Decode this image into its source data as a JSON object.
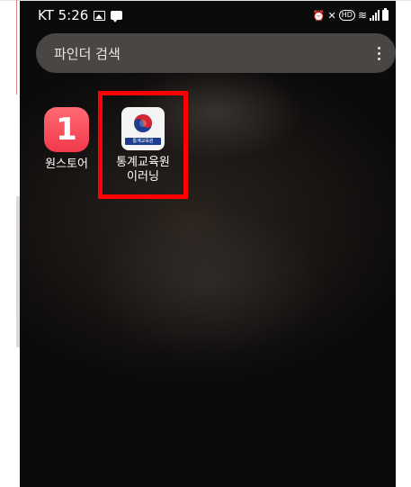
{
  "status_bar": {
    "time": "KT 5:26",
    "left_icons": [
      "gallery-icon",
      "message-icon"
    ],
    "right_icons": [
      "alarm-icon",
      "mute-icon",
      "hd-volte-icon",
      "wifi-icon",
      "signal-icon",
      "battery-icon"
    ],
    "hd_text": "HD"
  },
  "search": {
    "placeholder": "파인더 검색",
    "menu_icon": "more-vertical-icon"
  },
  "apps": [
    {
      "label": "원스토어",
      "icon": "onestore-icon",
      "icon_text": "1",
      "color": "#f2394b"
    },
    {
      "label": "통계교육원\n이러닝",
      "icon": "kostat-icon",
      "icon_text": "통계교육원",
      "color": "#1e3d8f"
    }
  ],
  "highlight_color": "#ff0000"
}
